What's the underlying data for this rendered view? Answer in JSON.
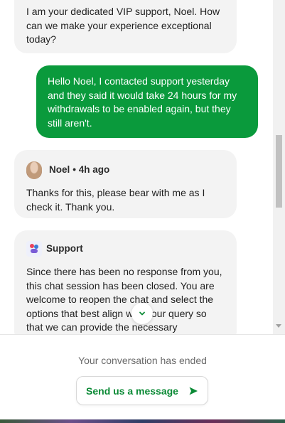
{
  "messages": {
    "agent_intro": "I am your dedicated VIP support, Noel. How can we make your experience exceptional today?",
    "user": "Hello Noel, I contacted support yesterday and they said it would take 24 hours for my withdrawals to be enabled again, but they still aren't.",
    "noel": {
      "name": "Noel",
      "time": "• 4h ago",
      "text": "Thanks for this, please bear with me as I check it. Thank you."
    },
    "support": {
      "name": "Support",
      "text": "Since there has been no response from you, this chat session has been closed. You are welcome to reopen the chat and select the options that best align with your query so that we can provide the necessary assistance."
    }
  },
  "footer": {
    "ended_text": "Your conversation has ended",
    "send_label": "Send us a message"
  },
  "colors": {
    "user_bubble": "#0a9a3c",
    "agent_bubble": "#f3f3f3",
    "accent": "#0a8a35"
  },
  "icons": {
    "jump_down": "chevron-down-icon",
    "send": "send-arrow-icon",
    "noel_avatar": "avatar",
    "support_avatar": "support-logo-icon"
  }
}
